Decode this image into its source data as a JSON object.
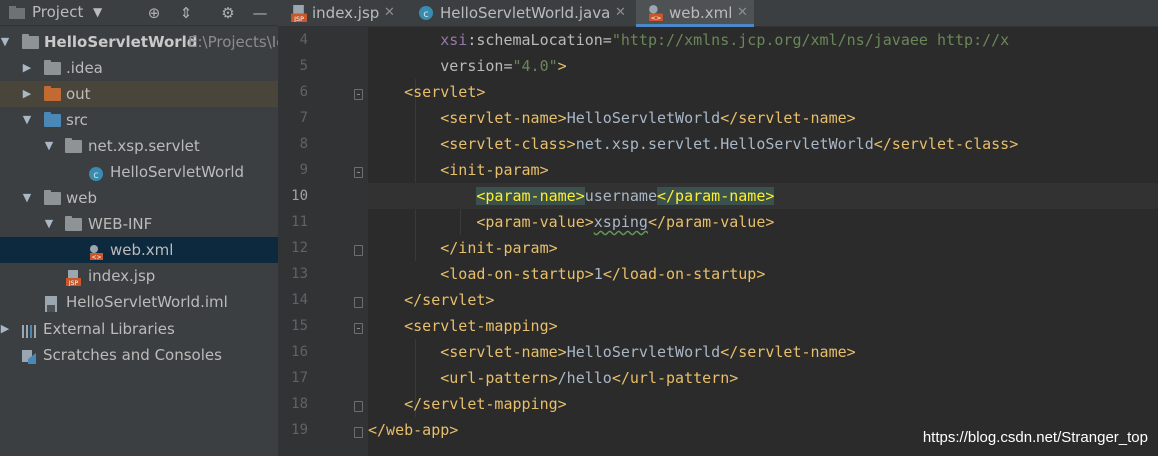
{
  "project_panel": {
    "title": "Project",
    "tree": [
      {
        "label": "HelloServletWorld",
        "suffix": "E:\\Projects\\Id",
        "icon": "project-folder-icon",
        "expanded": true,
        "bold": true
      },
      {
        "label": ".idea",
        "icon": "folder-icon",
        "expanded": false
      },
      {
        "label": "out",
        "icon": "excluded-folder-icon",
        "expanded": false
      },
      {
        "label": "src",
        "icon": "source-folder-icon",
        "expanded": true
      },
      {
        "label": "net.xsp.servlet",
        "icon": "package-icon",
        "expanded": true
      },
      {
        "label": "HelloServletWorld",
        "icon": "java-class-icon"
      },
      {
        "label": "web",
        "icon": "web-folder-icon",
        "expanded": true
      },
      {
        "label": "WEB-INF",
        "icon": "folder-icon",
        "expanded": true
      },
      {
        "label": "web.xml",
        "icon": "xml-config-icon",
        "selected": true
      },
      {
        "label": "index.jsp",
        "icon": "jsp-file-icon"
      },
      {
        "label": "HelloServletWorld.iml",
        "icon": "iml-file-icon"
      },
      {
        "label": "External Libraries",
        "icon": "libraries-icon",
        "expanded": false
      },
      {
        "label": "Scratches and Consoles",
        "icon": "scratches-icon"
      }
    ]
  },
  "tabs": [
    {
      "label": "index.jsp",
      "icon": "jsp-file-icon",
      "active": false
    },
    {
      "label": "HelloServletWorld.java",
      "icon": "java-class-icon",
      "active": false
    },
    {
      "label": "web.xml",
      "icon": "xml-config-icon",
      "active": true
    }
  ],
  "editor": {
    "line_numbers": [
      "4",
      "5",
      "6",
      "7",
      "8",
      "9",
      "10",
      "11",
      "12",
      "13",
      "14",
      "15",
      "16",
      "17",
      "18",
      "19"
    ],
    "current_line": "10",
    "lines": [
      "        xsi:schemaLocation=\"http://xmlns.jcp.org/xml/ns/javaee http://x",
      "        version=\"4.0\">",
      "    <servlet>",
      "        <servlet-name>HelloServletWorld</servlet-name>",
      "        <servlet-class>net.xsp.servlet.HelloServletWorld</servlet-class>",
      "        <init-param>",
      "            <param-name>username</param-name>",
      "            <param-value>xsping</param-value>",
      "        </init-param>",
      "        <load-on-startup>1</load-on-startup>",
      "    </servlet>",
      "    <servlet-mapping>",
      "        <servlet-name>HelloServletWorld</servlet-name>",
      "        <url-pattern>/hello</url-pattern>",
      "    </servlet-mapping>",
      "</web-app>"
    ]
  },
  "watermark": "https://blog.csdn.net/Stranger_top",
  "colors": {
    "tag": "#e8bf6a",
    "text": "#a9b7c6",
    "string": "#6a8759",
    "namespace": "#9876aa",
    "selection": "#0d293e",
    "accent": "#4a88c7"
  }
}
